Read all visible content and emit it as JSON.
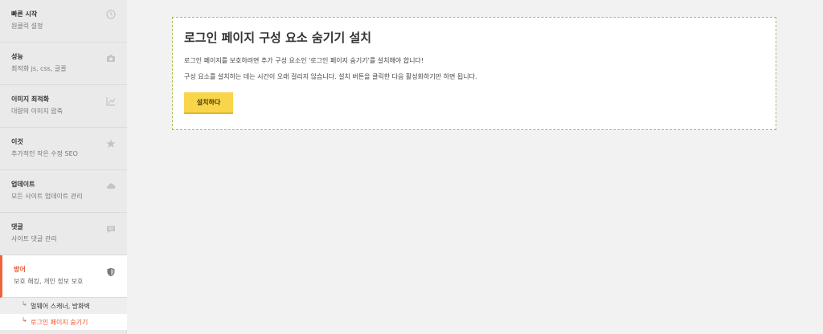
{
  "sidebar": {
    "items": [
      {
        "title": "빠른 시작",
        "subtitle": "원클릭 설정",
        "icon": "clock-icon"
      },
      {
        "title": "성능",
        "subtitle": "최적화 js, css, 글꼴",
        "icon": "camera-icon"
      },
      {
        "title": "이미지 최적화",
        "subtitle": "대량의 이미지 압축",
        "icon": "chart-icon"
      },
      {
        "title": "이것",
        "subtitle": "추가적인 작은 수정 SEO",
        "icon": "star-icon"
      },
      {
        "title": "업데이트",
        "subtitle": "모든 사이트 업데이트 관리",
        "icon": "cloud-icon"
      },
      {
        "title": "댓글",
        "subtitle": "사이트 댓글 관리",
        "icon": "comment-icon"
      },
      {
        "title": "방어",
        "subtitle": "보호 해킹, 개인 정보 보호",
        "icon": "shield-icon"
      }
    ],
    "subitems": [
      {
        "label": "멀웨어 스캐너, 방화벽"
      },
      {
        "label": "로그인 페이지 숨기기"
      }
    ]
  },
  "panel": {
    "title": "로그인 페이지 구성 요소 숨기기 설치",
    "line1": "로그인 페이지를 보호하려면 추가 구성 요소인 '로그인 페이지 숨기기'를 설치해야 합니다!",
    "line2": "구성 요소를 설치하는 데는 시간이 오래 걸리지 않습니다. 설치 버튼을 클릭한 다음 활성화하기만 하면 됩니다.",
    "button_label": "설치하다"
  },
  "colors": {
    "accent": "#f0643c",
    "button": "#f8d54a",
    "panel_border": "#a7c15a"
  }
}
